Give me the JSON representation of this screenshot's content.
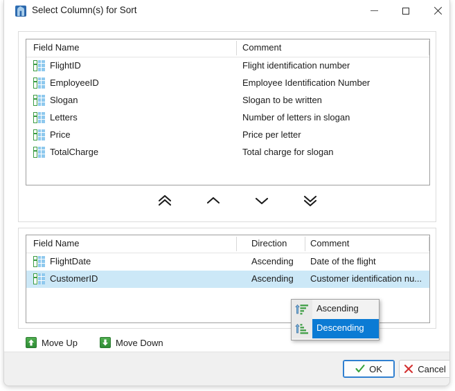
{
  "window": {
    "title": "Select Column(s) for Sort",
    "icon": "app-icon",
    "controls": {
      "minimize": "minimize-icon",
      "maximize": "maximize-icon",
      "close": "close-icon"
    }
  },
  "available_list": {
    "headers": {
      "field_name": "Field Name",
      "comment": "Comment"
    },
    "rows": [
      {
        "icon": "table-field-icon",
        "field": "FlightID",
        "comment": "Flight identification number"
      },
      {
        "icon": "table-field-icon",
        "field": "EmployeeID",
        "comment": "Employee Identification Number"
      },
      {
        "icon": "table-field-icon",
        "field": "Slogan",
        "comment": "Slogan to be written"
      },
      {
        "icon": "table-field-icon",
        "field": "Letters",
        "comment": "Number of letters in slogan"
      },
      {
        "icon": "table-field-icon",
        "field": "Price",
        "comment": "Price per letter"
      },
      {
        "icon": "table-field-icon",
        "field": "TotalCharge",
        "comment": "Total charge for slogan"
      }
    ]
  },
  "transfer_buttons": [
    {
      "name": "move-all-up",
      "icon": "double-chevron-up-icon"
    },
    {
      "name": "move-up",
      "icon": "chevron-up-icon"
    },
    {
      "name": "move-down",
      "icon": "chevron-down-icon"
    },
    {
      "name": "move-all-down",
      "icon": "double-chevron-down-icon"
    }
  ],
  "selected_list": {
    "headers": {
      "field_name": "Field Name",
      "direction": "Direction",
      "comment": "Comment"
    },
    "rows": [
      {
        "icon": "table-field-icon",
        "field": "FlightDate",
        "direction": "Ascending",
        "comment": "Date of the flight",
        "selected": false
      },
      {
        "icon": "table-field-icon",
        "field": "CustomerID",
        "direction": "Ascending",
        "comment": "Customer identification nu...",
        "selected": true
      }
    ]
  },
  "context_menu": {
    "items": [
      {
        "label": "Ascending",
        "icon": "sort-ascending-icon",
        "highlighted": false
      },
      {
        "label": "Descending",
        "icon": "sort-descending-icon",
        "highlighted": true
      }
    ]
  },
  "order_buttons": {
    "move_up": "Move Up",
    "move_down": "Move Down",
    "move_up_icon": "green-arrow-up-icon",
    "move_down_icon": "green-arrow-down-icon"
  },
  "dialog_buttons": {
    "ok": "OK",
    "cancel": "Cancel",
    "ok_icon": "green-check-icon",
    "cancel_icon": "red-x-icon"
  },
  "colors": {
    "selection_blue": "#cce8f7",
    "menu_highlight": "#0b7bd4",
    "accent_green": "#3b9c43",
    "accent_red": "#d33030",
    "focus_blue": "#2f7fd0",
    "footer_gray": "#f0f0f0"
  }
}
